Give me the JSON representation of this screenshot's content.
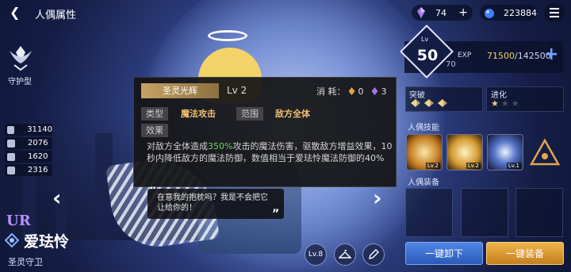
{
  "header": {
    "title": "人偶属性"
  },
  "resources": [
    {
      "name": "purple-crystal",
      "value": "74"
    },
    {
      "name": "blue-orb",
      "value": "223884"
    }
  ],
  "left": {
    "class_label": "守护型",
    "stats": [
      "31140",
      "2076",
      "1620",
      "2316"
    ],
    "rarity": "UR",
    "name": "爱珐怜",
    "title": "圣灵守卫"
  },
  "tooltip": {
    "skill_name": "圣灵光辉",
    "level": "Lv 2",
    "cost_label": "消 耗：",
    "cost_gold": "0",
    "cost_purple": "3",
    "type_key": "类型",
    "type_value": "魔法攻击",
    "range_key": "范围",
    "range_value": "敌方全体",
    "effect_key": "效果",
    "desc_pre": "对敌方全体造成",
    "desc_hl": "350%",
    "desc_post": "攻击的魔法伤害，驱散敌方增益效果，10秒内降低敌方的魔法防御，数值相当于爱珐怜魔法防御的40%"
  },
  "dialogue": {
    "text": "在意我的抱枕吗？我是不会把它让给你的！"
  },
  "bottom_buttons": {
    "level_badge": "Lv.8"
  },
  "right": {
    "level_small": "Lv",
    "level": "50",
    "level_max": "70",
    "exp_label": "EXP",
    "exp_current": "71500",
    "exp_total": "/142500",
    "breakthrough_label": "突破",
    "evolution_label": "进化",
    "evolution_stars_filled": 1,
    "evolution_stars_total": 3,
    "skills_label": "人偶技能",
    "skills": [
      {
        "name": "skill-1",
        "level": "Lv.2"
      },
      {
        "name": "skill-2",
        "level": "Lv.2"
      },
      {
        "name": "skill-3",
        "level": "Lv.1"
      },
      {
        "name": "skill-4-locked",
        "level": ""
      }
    ],
    "equipment_label": "人偶装备",
    "unequip_all": "一键卸下",
    "equip_all": "一键装备"
  },
  "colors": {
    "highlight_green": "#63d65d",
    "gold": "#f2c06f",
    "exp_gold": "#f5cf5e",
    "button_blue": "#2b59b8",
    "button_gold": "#c47f1f"
  }
}
